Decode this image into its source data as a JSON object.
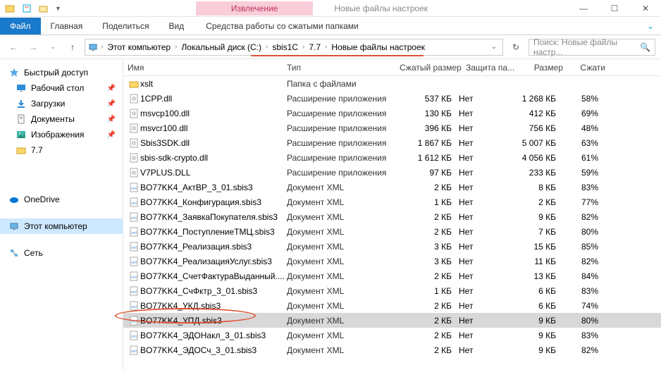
{
  "window": {
    "tab_extract": "Извлечение",
    "title": "Новые файлы настроек",
    "ribbon": {
      "file": "Файл",
      "home": "Главная",
      "share": "Поделиться",
      "view": "Вид",
      "archive_tools": "Средства работы со сжатыми папками"
    }
  },
  "breadcrumb": {
    "items": [
      "Этот компьютер",
      "Локальный диск (C:)",
      "sbis1C",
      "7.7",
      "Новые файлы настроек"
    ]
  },
  "search": {
    "placeholder": "Поиск: Новые файлы настр..."
  },
  "sidebar": {
    "quick": "Быстрый доступ",
    "desktop": "Рабочий стол",
    "downloads": "Загрузки",
    "documents": "Документы",
    "pictures": "Изображения",
    "folder77": "7.7",
    "onedrive": "OneDrive",
    "thispc": "Этот компьютер",
    "network": "Сеть"
  },
  "columns": {
    "name": "Имя",
    "type": "Тип",
    "compressed": "Сжатый размер",
    "protection": "Защита па...",
    "size": "Размер",
    "ratio": "Сжати"
  },
  "files": [
    {
      "icon": "folder",
      "name": "xslt",
      "type": "Папка с файлами",
      "comp": "",
      "prot": "",
      "size": "",
      "ratio": "",
      "sel": false
    },
    {
      "icon": "dll",
      "name": "1CPP.dll",
      "type": "Расширение приложения",
      "comp": "537 КБ",
      "prot": "Нет",
      "size": "1 268 КБ",
      "ratio": "58%",
      "sel": false
    },
    {
      "icon": "dll",
      "name": "msvcp100.dll",
      "type": "Расширение приложения",
      "comp": "130 КБ",
      "prot": "Нет",
      "size": "412 КБ",
      "ratio": "69%",
      "sel": false
    },
    {
      "icon": "dll",
      "name": "msvcr100.dll",
      "type": "Расширение приложения",
      "comp": "396 КБ",
      "prot": "Нет",
      "size": "756 КБ",
      "ratio": "48%",
      "sel": false
    },
    {
      "icon": "dll",
      "name": "Sbis3SDK.dll",
      "type": "Расширение приложения",
      "comp": "1 867 КБ",
      "prot": "Нет",
      "size": "5 007 КБ",
      "ratio": "63%",
      "sel": false
    },
    {
      "icon": "dll",
      "name": "sbis-sdk-crypto.dll",
      "type": "Расширение приложения",
      "comp": "1 612 КБ",
      "prot": "Нет",
      "size": "4 056 КБ",
      "ratio": "61%",
      "sel": false
    },
    {
      "icon": "dll",
      "name": "V7PLUS.DLL",
      "type": "Расширение приложения",
      "comp": "97 КБ",
      "prot": "Нет",
      "size": "233 КБ",
      "ratio": "59%",
      "sel": false
    },
    {
      "icon": "xml",
      "name": "BO77KK4_АктВР_3_01.sbis3",
      "type": "Документ XML",
      "comp": "2 КБ",
      "prot": "Нет",
      "size": "8 КБ",
      "ratio": "83%",
      "sel": false
    },
    {
      "icon": "xml",
      "name": "BO77KK4_Конфигурация.sbis3",
      "type": "Документ XML",
      "comp": "1 КБ",
      "prot": "Нет",
      "size": "2 КБ",
      "ratio": "77%",
      "sel": false
    },
    {
      "icon": "xml",
      "name": "BO77KK4_ЗаявкаПокупателя.sbis3",
      "type": "Документ XML",
      "comp": "2 КБ",
      "prot": "Нет",
      "size": "9 КБ",
      "ratio": "82%",
      "sel": false
    },
    {
      "icon": "xml",
      "name": "BO77KK4_ПоступлениеТМЦ.sbis3",
      "type": "Документ XML",
      "comp": "2 КБ",
      "prot": "Нет",
      "size": "7 КБ",
      "ratio": "80%",
      "sel": false
    },
    {
      "icon": "xml",
      "name": "BO77KK4_Реализация.sbis3",
      "type": "Документ XML",
      "comp": "3 КБ",
      "prot": "Нет",
      "size": "15 КБ",
      "ratio": "85%",
      "sel": false
    },
    {
      "icon": "xml",
      "name": "BO77KK4_РеализацияУслуг.sbis3",
      "type": "Документ XML",
      "comp": "3 КБ",
      "prot": "Нет",
      "size": "11 КБ",
      "ratio": "82%",
      "sel": false
    },
    {
      "icon": "xml",
      "name": "BO77KK4_СчетФактураВыданный....",
      "type": "Документ XML",
      "comp": "2 КБ",
      "prot": "Нет",
      "size": "13 КБ",
      "ratio": "84%",
      "sel": false
    },
    {
      "icon": "xml",
      "name": "BO77KK4_СчФктр_3_01.sbis3",
      "type": "Документ XML",
      "comp": "1 КБ",
      "prot": "Нет",
      "size": "6 КБ",
      "ratio": "83%",
      "sel": false
    },
    {
      "icon": "xml",
      "name": "BO77KK4_УКД.sbis3",
      "type": "Документ XML",
      "comp": "2 КБ",
      "prot": "Нет",
      "size": "6 КБ",
      "ratio": "74%",
      "sel": false
    },
    {
      "icon": "xml",
      "name": "BO77KK4_УПД.sbis3",
      "type": "Документ XML",
      "comp": "2 КБ",
      "prot": "Нет",
      "size": "9 КБ",
      "ratio": "80%",
      "sel": true
    },
    {
      "icon": "xml",
      "name": "BO77KK4_ЭДОНакл_3_01.sbis3",
      "type": "Документ XML",
      "comp": "2 КБ",
      "prot": "Нет",
      "size": "9 КБ",
      "ratio": "83%",
      "sel": false
    },
    {
      "icon": "xml",
      "name": "BO77KK4_ЭДОСч_3_01.sbis3",
      "type": "Документ XML",
      "comp": "2 КБ",
      "prot": "Нет",
      "size": "9 КБ",
      "ratio": "82%",
      "sel": false
    }
  ]
}
